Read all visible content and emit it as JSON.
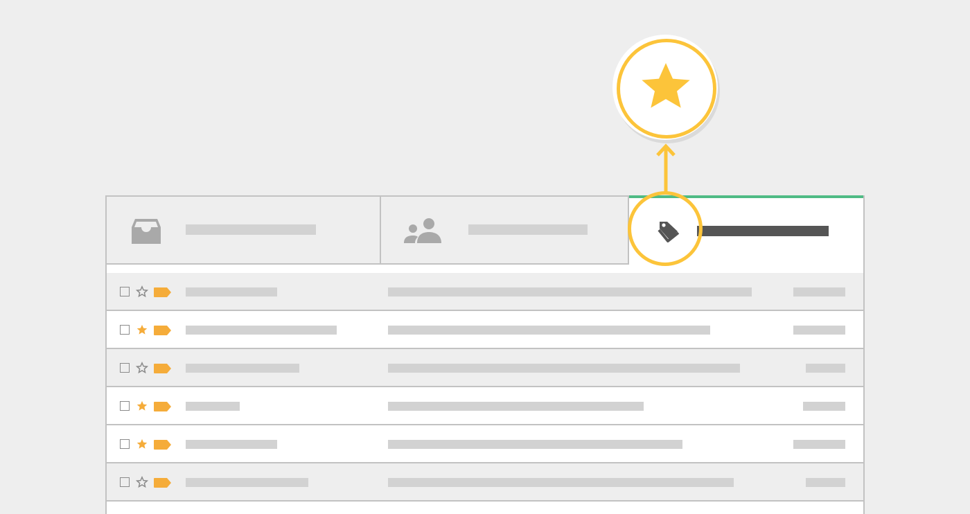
{
  "colors": {
    "background": "#eeeeee",
    "accent_yellow": "#fcc43a",
    "label_orange": "#f5ac3a",
    "active_tab_border": "#4fbb85",
    "placeholder_bar": "#d2d2d2",
    "active_tab_bar": "#555555",
    "border": "#c2c2c2"
  },
  "callout": {
    "icon": "star-icon",
    "points_to": "tab-promotions"
  },
  "tabs": [
    {
      "id": "primary",
      "icon": "inbox-icon",
      "active": false
    },
    {
      "id": "social",
      "icon": "people-icon",
      "active": false
    },
    {
      "id": "promotions",
      "icon": "tag-icon",
      "active": true
    }
  ],
  "rows": [
    {
      "starred": false,
      "labeled": true,
      "shaded": true
    },
    {
      "starred": true,
      "labeled": true,
      "shaded": false
    },
    {
      "starred": false,
      "labeled": true,
      "shaded": true
    },
    {
      "starred": true,
      "labeled": true,
      "shaded": false
    },
    {
      "starred": true,
      "labeled": true,
      "shaded": false
    },
    {
      "starred": false,
      "labeled": true,
      "shaded": true
    }
  ]
}
